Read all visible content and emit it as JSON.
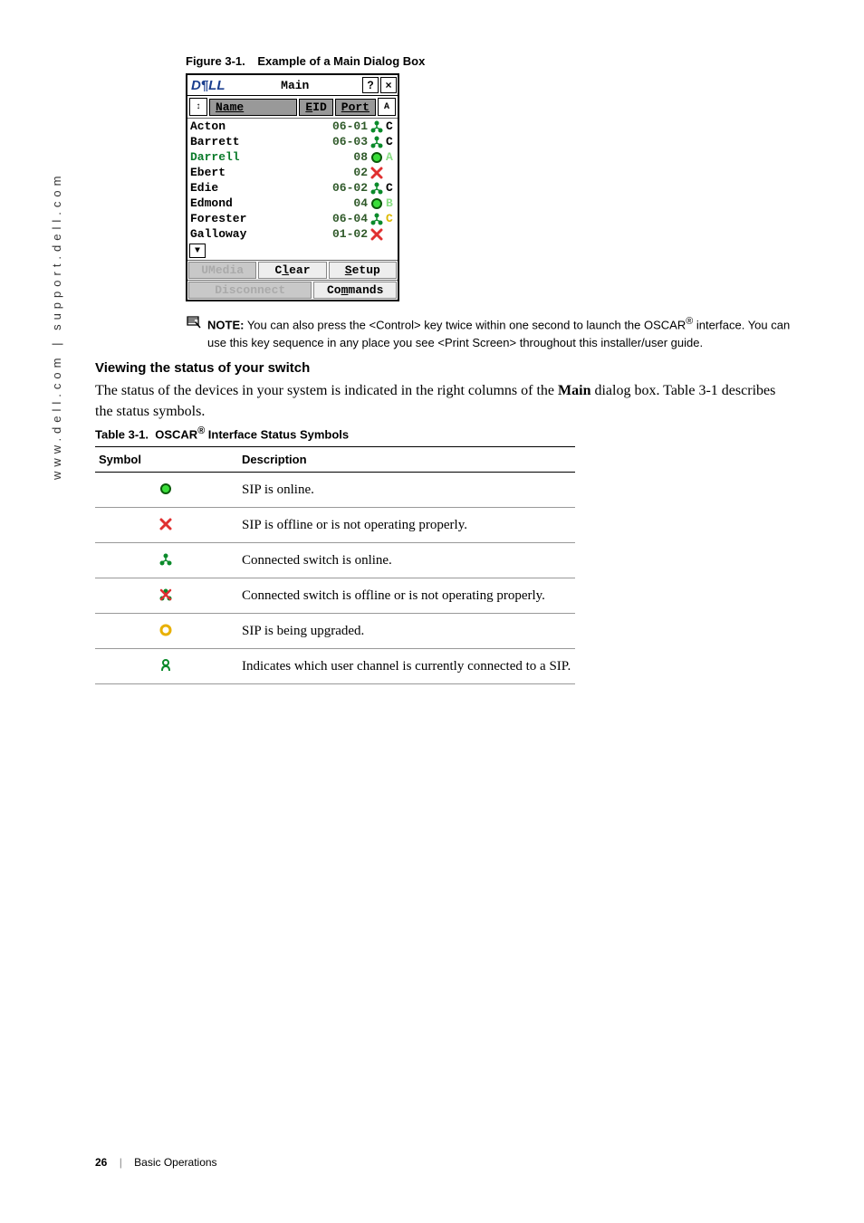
{
  "side_url": "www.dell.com | support.dell.com",
  "figure_label": "Figure 3-1.",
  "figure_title": "Example of a Main Dialog Box",
  "dialog": {
    "logo": "D¶LL",
    "title": "Main",
    "help": "?",
    "close": "×",
    "sort": "↕",
    "name_btn": "Name",
    "eid_btn": "EID",
    "port_btn": "Port",
    "flag": "A",
    "rows": [
      {
        "name": "Acton",
        "port": "06-01",
        "st": "tree-g",
        "ch": "C",
        "color": "#000"
      },
      {
        "name": "Barrett",
        "port": "06-03",
        "st": "tree-g",
        "ch": "C",
        "color": "#000"
      },
      {
        "name": "Darrell",
        "port": "08",
        "st": "circ-g",
        "ch": "A",
        "color": "#0a7a2a",
        "chcol": "#8adf85"
      },
      {
        "name": "Ebert",
        "port": "02",
        "st": "x-r",
        "ch": "",
        "color": "#000"
      },
      {
        "name": "Edie",
        "port": "06-02",
        "st": "tree-g",
        "ch": "C",
        "color": "#000"
      },
      {
        "name": "Edmond",
        "port": "04",
        "st": "circ-g",
        "ch": "B",
        "color": "#000",
        "chcol": "#8adf85"
      },
      {
        "name": "Forester",
        "port": "06-04",
        "st": "tree-g",
        "ch": "C",
        "color": "#000",
        "chcol": "#ddb900"
      },
      {
        "name": "Galloway",
        "port": "01-02",
        "st": "x-r",
        "ch": "",
        "color": "#000"
      }
    ],
    "down": "▼",
    "umedia": "UMedia",
    "clear": "Clear",
    "setup": "Setup",
    "disconnect": "Disconnect",
    "commands": "Commands"
  },
  "note_prefix": "NOTE:",
  "note_text_1": " You can also press the <Control> key twice within one second to launch the OSCAR",
  "note_text_2": " interface. You can use this key sequence in any place you see <Print Screen> throughout this installer/user guide.",
  "note_reg": "®",
  "subhead": "Viewing the status of your switch",
  "para_1": "The status of the devices in your system is indicated in the right columns of the ",
  "para_main": "Main",
  "para_2": " dialog box. Table 3-1 describes the status symbols.",
  "table_label_1": "Table 3-1.",
  "table_label_2": "OSCAR",
  "table_label_3": " Interface Status Symbols",
  "th_symbol": "Symbol",
  "th_desc": "Description",
  "table_rows": [
    {
      "sym": "circ-g",
      "desc": "SIP is online."
    },
    {
      "sym": "x-r",
      "desc": "SIP is offline or is not operating properly."
    },
    {
      "sym": "tree-g",
      "desc": "Connected switch is online."
    },
    {
      "sym": "tree-r",
      "desc": "Connected switch is offline or is not operating properly."
    },
    {
      "sym": "circ-y",
      "desc": "SIP is being upgraded."
    },
    {
      "sym": "user-g",
      "desc": "Indicates which user channel is currently connected to a SIP."
    }
  ],
  "page_num": "26",
  "page_sect": "Basic Operations"
}
